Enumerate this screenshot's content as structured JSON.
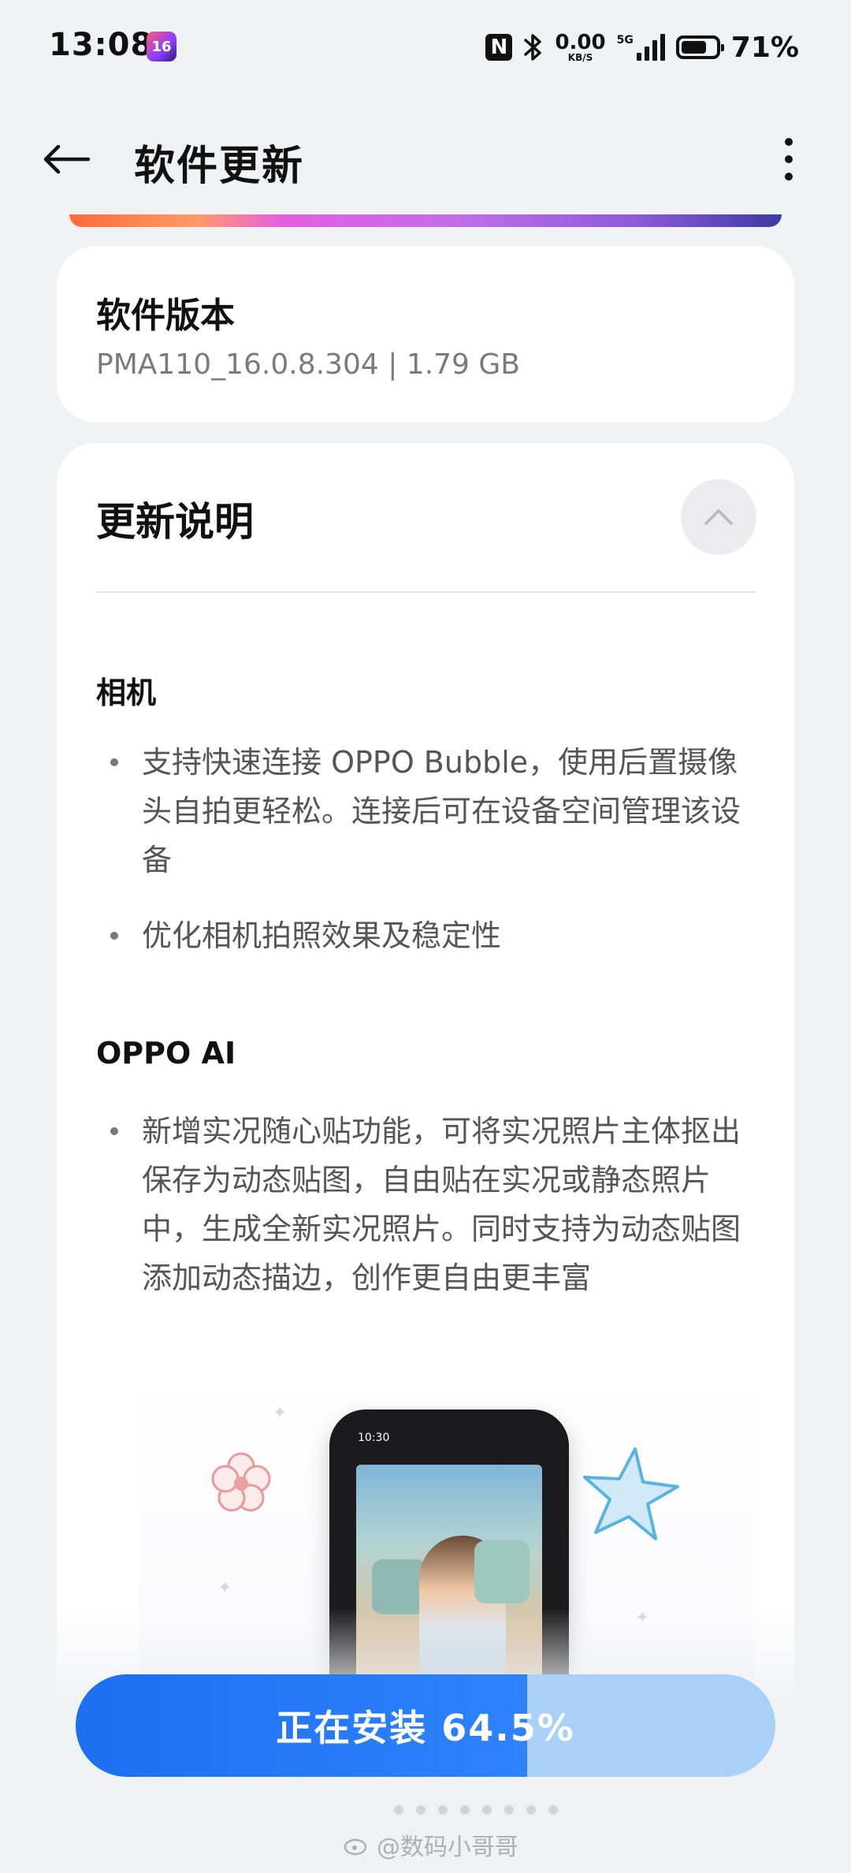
{
  "status_bar": {
    "time": "13:08",
    "app_badge": "16",
    "nfc": "N",
    "net_speed_value": "0.00",
    "net_speed_unit": "KB/S",
    "network_type": "5G",
    "battery_percent": "71%",
    "battery_level": 0.71
  },
  "header": {
    "title": "软件更新",
    "back_icon": "arrow-left-icon",
    "more_icon": "more-vertical-icon"
  },
  "version_card": {
    "title": "软件版本",
    "info": "PMA110_16.0.8.304 | 1.79 GB"
  },
  "notes": {
    "title": "更新说明",
    "collapse_icon": "chevron-up-icon",
    "sections": [
      {
        "heading": "相机",
        "bullets": [
          "支持快速连接 OPPO Bubble，使用后置摄像头自拍更轻松。连接后可在设备空间管理该设备",
          "优化相机拍照效果及稳定性"
        ]
      },
      {
        "heading": "OPPO AI",
        "bullets": [
          "新增实况随心贴功能，可将实况照片主体抠出保存为动态贴图，自由贴在实况或静态照片中，生成全新实况照片。同时支持为动态贴图添加动态描边，创作更自由更丰富"
        ]
      }
    ],
    "illustration": {
      "phone_time": "10:30"
    }
  },
  "install": {
    "label": "正在安装 64.5%",
    "progress_percent": 64.5,
    "colors": {
      "fill": "#1d6ff2",
      "track": "#a8d0f8"
    }
  },
  "watermark": "@数码小哥哥"
}
